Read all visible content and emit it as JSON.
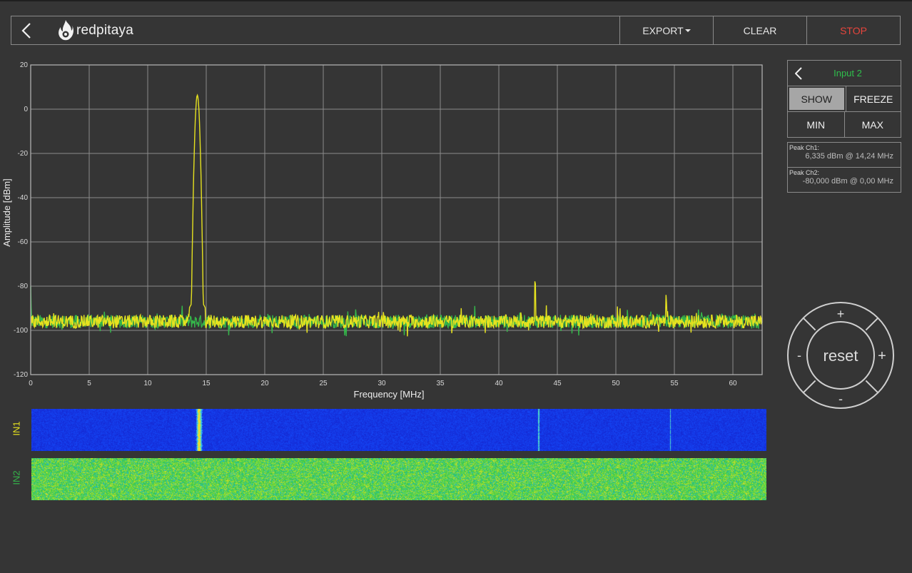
{
  "header": {
    "logo_text": "redpitaya",
    "export_label": "EXPORT",
    "clear_label": "CLEAR",
    "stop_label": "STOP"
  },
  "colors": {
    "ch1": "#e6e21f",
    "ch2": "#35b54a",
    "stop": "#e8453c",
    "background": "#353535"
  },
  "panel": {
    "title": "Input 2",
    "show_label": "SHOW",
    "freeze_label": "FREEZE",
    "min_label": "MIN",
    "max_label": "MAX"
  },
  "peaks": [
    {
      "label": "Peak Ch1:",
      "value": "6,335 dBm @ 14,24 MHz"
    },
    {
      "label": "Peak Ch2:",
      "value": "-80,000 dBm @ 0,00 MHz"
    }
  ],
  "waterfall": {
    "in1_label": "IN1",
    "in2_label": "IN2"
  },
  "dpad": {
    "plus": "+",
    "minus": "-",
    "reset": "reset"
  },
  "chart_data": {
    "type": "line",
    "xlabel": "Frequency [MHz]",
    "ylabel": "Amplitude [dBm]",
    "xlim": [
      0,
      62.5
    ],
    "ylim": [
      -120,
      20
    ],
    "x_ticks": [
      0,
      5,
      10,
      15,
      20,
      25,
      30,
      35,
      40,
      45,
      50,
      55,
      60
    ],
    "y_ticks": [
      20,
      0,
      -20,
      -40,
      -60,
      -80,
      -100,
      -120
    ],
    "grid": true,
    "noise_floor_dbm": -96,
    "series": [
      {
        "color": "#e6e21f",
        "peaks": [
          {
            "x": 14.24,
            "y": 6.335
          },
          {
            "x": 43.1,
            "y": -76
          },
          {
            "x": 54.3,
            "y": -83
          }
        ]
      },
      {
        "color": "#35b54a",
        "peaks": [
          {
            "x": 0.0,
            "y": -80
          }
        ]
      }
    ]
  }
}
